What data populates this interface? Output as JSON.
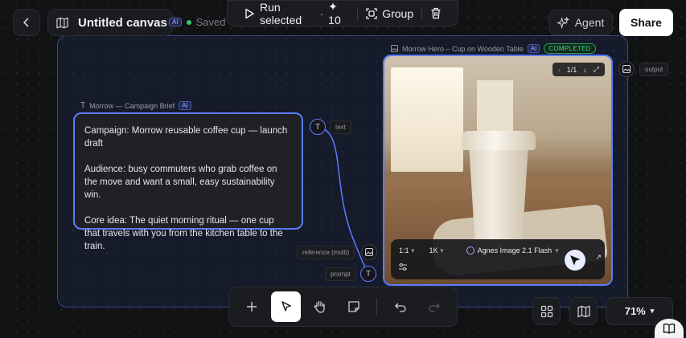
{
  "header": {
    "back_icon": "chevron-left-icon",
    "canvas_icon": "map-icon",
    "title": "Untitled canvas",
    "ai_badge": "AI",
    "save_status": "Saved"
  },
  "top_toolbar": {
    "run_label": "Run selected",
    "run_count": "✦ 10",
    "group_label": "Group"
  },
  "agent_label": "Agent",
  "share_label": "Share",
  "text_node": {
    "title": "Morrow — Campaign Brief",
    "ai_badge": "AI",
    "paragraphs": [
      "Campaign: Morrow reusable coffee cup — launch draft",
      "Audience: busy commuters who grab coffee on the move and want a small, easy sustainability win.",
      "Core idea: The quiet morning ritual — one cup that travels with you from the kitchen table to the train."
    ],
    "port_text_label": "text"
  },
  "image_node": {
    "title": "Morrow Hero – Cup on Wooden Table",
    "ai_badge": "AI",
    "status": "COMPLETED",
    "pager": "1/1",
    "output_label": "output",
    "port_reference_label": "reference (multi)",
    "port_prompt_label": "prompt",
    "gen_bar": {
      "aspect": "1:1",
      "resolution": "1K",
      "model": "Agnes Image 2.1 Flash"
    }
  },
  "zoom": "71%",
  "colors": {
    "accent": "#5b7bff",
    "completed": "#3ddc84",
    "saved_dot": "#2ecc71"
  }
}
